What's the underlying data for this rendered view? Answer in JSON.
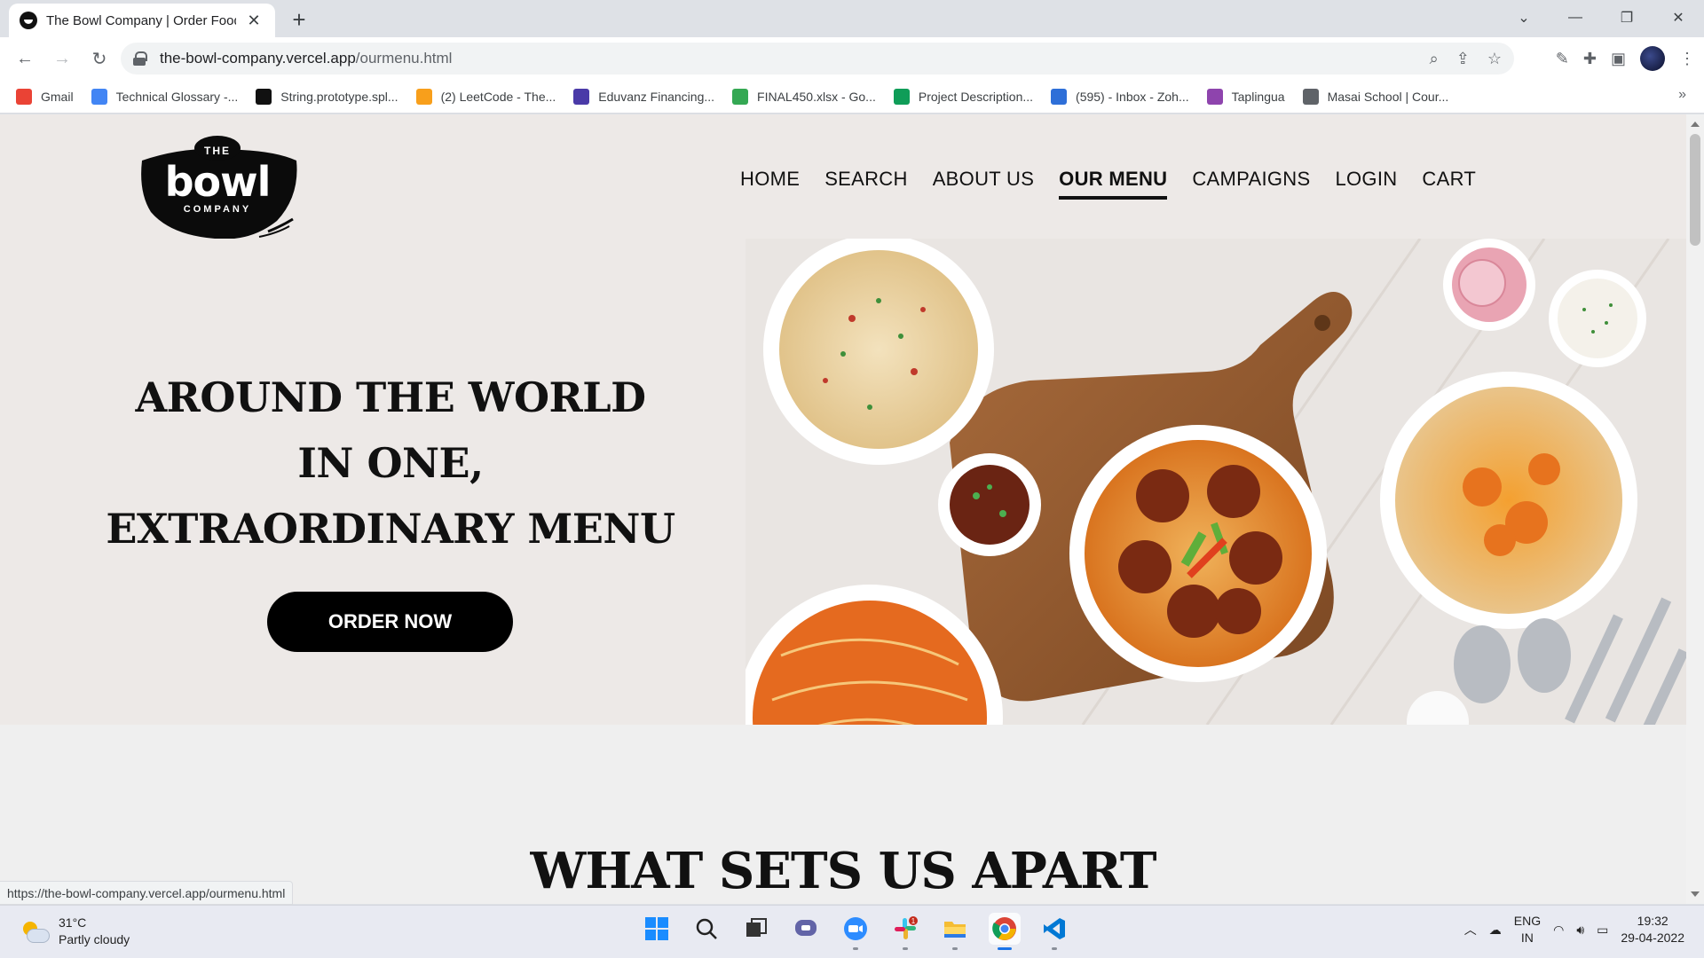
{
  "browser": {
    "tab_title": "The Bowl Company | Order Food",
    "url_domain": "the-bowl-company.vercel.app",
    "url_path": "/ourmenu.html",
    "status_url": "https://the-bowl-company.vercel.app/ourmenu.html"
  },
  "bookmarks": [
    {
      "label": "Gmail",
      "icon": "gmail-icon",
      "color": "#ea4335"
    },
    {
      "label": "Technical Glossary -...",
      "icon": "docs-icon",
      "color": "#4285f4"
    },
    {
      "label": "String.prototype.spl...",
      "icon": "mdn-icon",
      "color": "#111111"
    },
    {
      "label": "(2) LeetCode - The...",
      "icon": "leetcode-icon",
      "color": "#f89f1b"
    },
    {
      "label": "Eduvanz Financing...",
      "icon": "eduvanz-icon",
      "color": "#4a3aa8"
    },
    {
      "label": "FINAL450.xlsx - Go...",
      "icon": "drive-icon",
      "color": "#34a853"
    },
    {
      "label": "Project Description...",
      "icon": "sheets-icon",
      "color": "#0f9d58"
    },
    {
      "label": "(595) - Inbox - Zoh...",
      "icon": "zoho-mail-icon",
      "color": "#2e6fd8"
    },
    {
      "label": "Taplingua",
      "icon": "taplingua-icon",
      "color": "#8e44ad"
    },
    {
      "label": "Masai School | Cour...",
      "icon": "globe-icon",
      "color": "#5f6368"
    }
  ],
  "site": {
    "logo_top": "THE",
    "logo_main": "bowl",
    "logo_bottom": "COMPANY",
    "nav": [
      {
        "label": "HOME",
        "active": false
      },
      {
        "label": "SEARCH",
        "active": false
      },
      {
        "label": "ABOUT US",
        "active": false
      },
      {
        "label": "OUR MENU",
        "active": true
      },
      {
        "label": "CAMPAIGNS",
        "active": false
      },
      {
        "label": "LOGIN",
        "active": false
      },
      {
        "label": "CART",
        "active": false
      }
    ],
    "headline_lines": [
      "AROUND THE WORLD",
      "IN ONE,",
      "EXTRAORDINARY MENU"
    ],
    "cta": "ORDER NOW",
    "section_title": "WHAT SETS US APART"
  },
  "taskbar": {
    "temperature": "31°C",
    "weather": "Partly cloudy",
    "lang_top": "ENG",
    "lang_bottom": "IN",
    "time": "19:32",
    "date": "29-04-2022",
    "slack_badge": "1"
  },
  "colors": {
    "hero_bg": "#ede9e7",
    "page_bg": "#efefef",
    "cta_bg": "#000000",
    "accent_blue": "#1a73e8"
  }
}
